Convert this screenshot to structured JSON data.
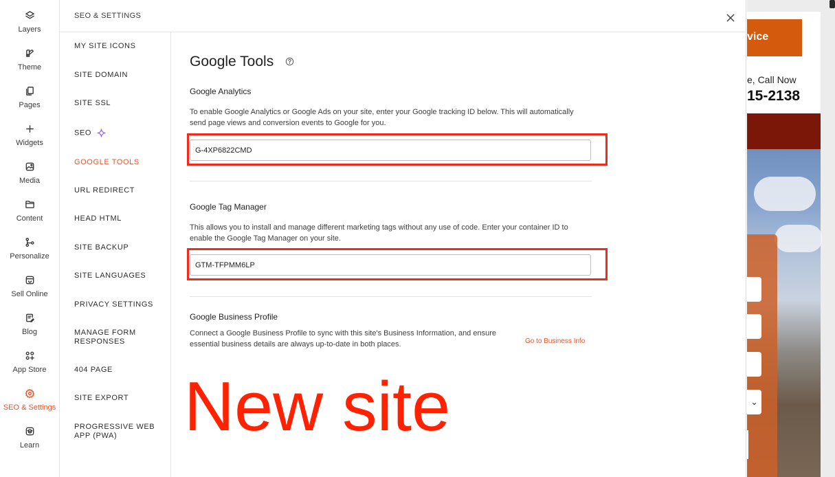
{
  "rail": {
    "items": [
      {
        "label": "Layers",
        "icon": "layers-icon"
      },
      {
        "label": "Theme",
        "icon": "palette-icon"
      },
      {
        "label": "Pages",
        "icon": "pages-icon"
      },
      {
        "label": "Widgets",
        "icon": "plus-icon"
      },
      {
        "label": "Media",
        "icon": "image-icon"
      },
      {
        "label": "Content",
        "icon": "folder-icon"
      },
      {
        "label": "Personalize",
        "icon": "branch-icon"
      },
      {
        "label": "Sell Online",
        "icon": "store-icon"
      },
      {
        "label": "Blog",
        "icon": "blog-icon"
      },
      {
        "label": "App Store",
        "icon": "apps-icon"
      },
      {
        "label": "SEO & Settings",
        "icon": "gear-icon",
        "active": true
      },
      {
        "label": "Learn",
        "icon": "graduation-cap-icon"
      }
    ]
  },
  "panel": {
    "title": "SEO & SETTINGS"
  },
  "subnav": {
    "items": [
      {
        "label": "MY SITE ICONS"
      },
      {
        "label": "SITE DOMAIN"
      },
      {
        "label": "SITE SSL"
      },
      {
        "label": "SEO"
      },
      {
        "label": "GOOGLE TOOLS",
        "active": true
      },
      {
        "label": "URL REDIRECT"
      },
      {
        "label": "HEAD HTML"
      },
      {
        "label": "SITE BACKUP"
      },
      {
        "label": "SITE LANGUAGES"
      },
      {
        "label": "PRIVACY SETTINGS"
      },
      {
        "label": "MANAGE FORM RESPONSES"
      },
      {
        "label": "404 PAGE"
      },
      {
        "label": "SITE EXPORT"
      },
      {
        "label": "PROGRESSIVE WEB APP (PWA)"
      }
    ]
  },
  "main": {
    "title": "Google Tools",
    "analytics": {
      "title": "Google Analytics",
      "description": "To enable Google Analytics or Google Ads on your site, enter your Google tracking ID below. This will automatically send page views and conversion events to Google for you.",
      "value": "G-4XP6822CMD"
    },
    "tag_manager": {
      "title": "Google Tag Manager",
      "description": "This allows you to install and manage different marketing tags without any use of code. Enter your container ID to enable the Google Tag Manager on your site.",
      "value": "GTM-TFPMM6LP"
    },
    "business_profile": {
      "title": "Google Business Profile",
      "description": "Connect a Google Business Profile to sync with this site's Business Information, and ensure essential business details are always up-to-date in both places.",
      "link": "Go to Business Info"
    },
    "overlay_text": "New site"
  },
  "preview": {
    "service_button": "vice",
    "call_text": "e, Call Now",
    "phone": "15-2138",
    "select_chevron": "⌄"
  },
  "colors": {
    "accent": "#e4572e",
    "highlight": "#ee2b1c",
    "overlay_text": "#ff2200",
    "preview_orange": "#d45a0e",
    "preview_dark_red": "#7a1708"
  }
}
